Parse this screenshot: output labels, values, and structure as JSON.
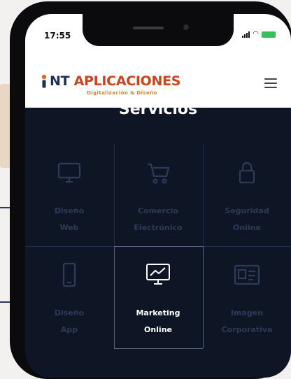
{
  "status_bar": {
    "time": "17:55"
  },
  "header": {
    "logo_nt": "NT",
    "logo_rest": " APLICACIONES",
    "tagline": "Digitalización & Diseño"
  },
  "page_title": "Servicios",
  "services": [
    {
      "line1": "Diseño",
      "line2": "Web",
      "icon": "monitor-icon"
    },
    {
      "line1": "Comercio",
      "line2": "Electrónico",
      "icon": "shopping-cart-icon"
    },
    {
      "line1": "Seguridad",
      "line2": "Online",
      "icon": "lock-icon"
    },
    {
      "line1": "Diseño",
      "line2": "App",
      "icon": "mobile-icon"
    },
    {
      "line1": "Marketing",
      "line2": "Online",
      "icon": "analytics-monitor-icon"
    },
    {
      "line1": "Imagen",
      "line2": "Corporativa",
      "icon": "id-card-icon"
    }
  ],
  "colors": {
    "brand_orange": "#c8461e",
    "brand_navy": "#1c2d5a",
    "background": "#0e1626"
  }
}
